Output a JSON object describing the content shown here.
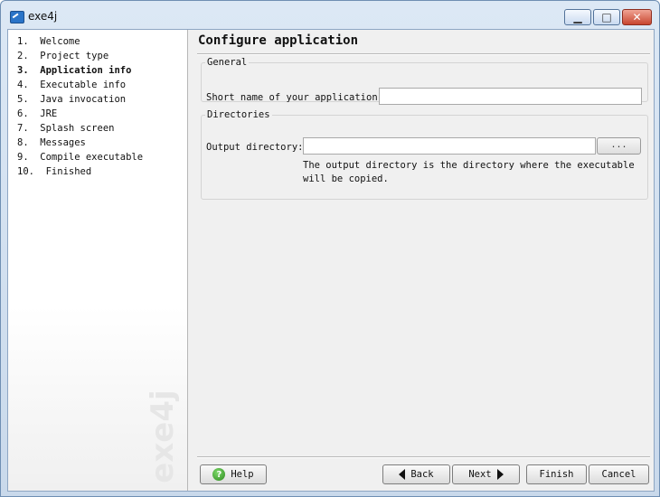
{
  "window": {
    "title": "exe4j",
    "icons": {
      "app": "exe4j-app-icon",
      "minimize": "minimize-icon",
      "maximize": "maximize-icon",
      "close": "close-icon"
    },
    "glyphs": {
      "minimize": "▁",
      "maximize": "□",
      "close": "✕"
    }
  },
  "sidebar": {
    "steps": [
      "1.  Welcome",
      "2.  Project type",
      "3.  Application info",
      "4.  Executable info",
      "5.  Java invocation",
      "6.  JRE",
      "7.  Splash screen",
      "8.  Messages",
      "9.  Compile executable",
      "10.  Finished"
    ],
    "current_step": 2,
    "watermark": "exe4j"
  },
  "content": {
    "page_title": "Configure application",
    "general": {
      "legend": "General",
      "short_name_label": "Short name of your application:",
      "short_name_value": ""
    },
    "directories": {
      "legend": "Directories",
      "output_label": "Output directory:",
      "output_value": "",
      "browse_label": "...",
      "hint_line1": "The output directory is the directory where the executable",
      "hint_line2": "will be copied."
    }
  },
  "footer": {
    "help": "Help",
    "back": "Back",
    "next": "Next",
    "finish": "Finish",
    "cancel": "Cancel"
  },
  "colors": {
    "accent": "#2a74c8",
    "close_button": "#c8452f",
    "help_icon": "#2e8a1f"
  }
}
